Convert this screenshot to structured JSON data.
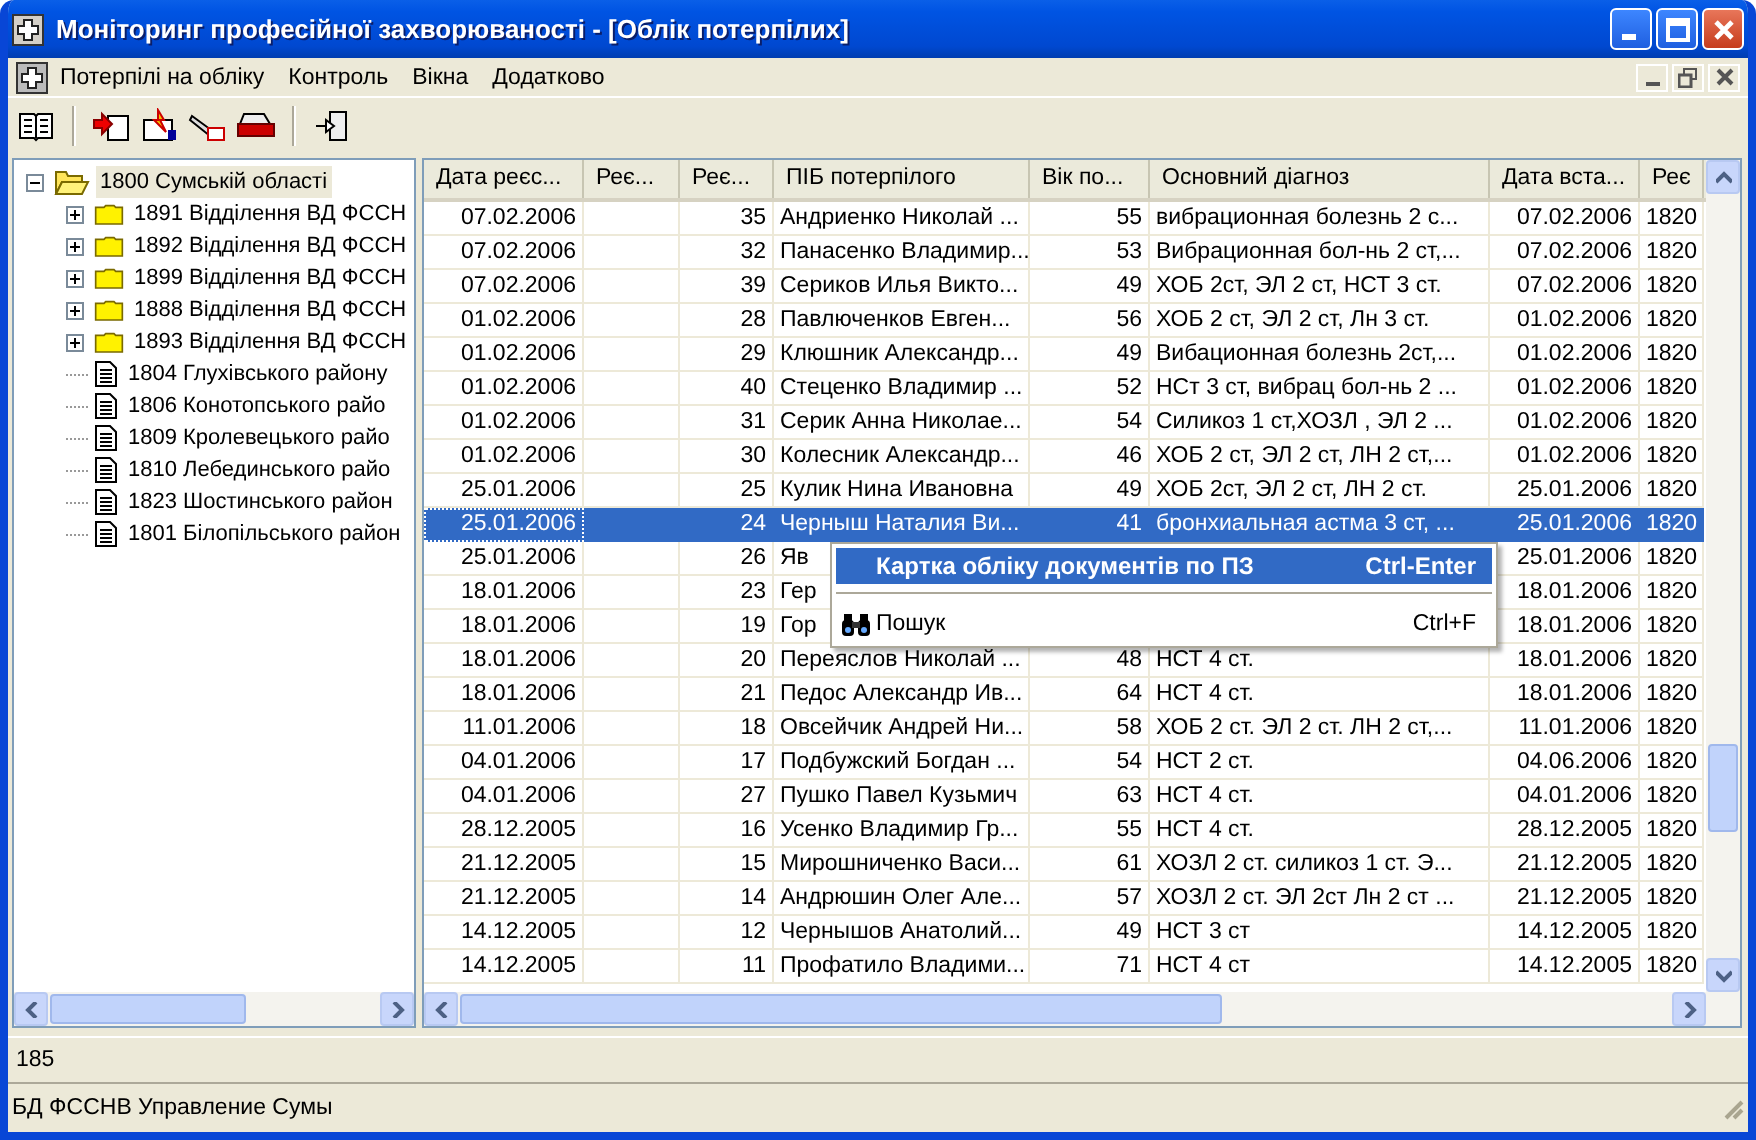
{
  "window": {
    "title": "Моніторинг професійної захворюваності - [Облік потерпілих]"
  },
  "menu": [
    "Потерпілі на обліку",
    "Контроль",
    "Вікна",
    "Додатково"
  ],
  "tree": [
    {
      "label": "1800  Сумській області",
      "kind": "folder",
      "expanded": true,
      "selected": true,
      "children": [
        {
          "label": "1891 Відділення ВД ФССН",
          "kind": "folder",
          "expanded": false,
          "selected": false
        },
        {
          "label": "1892 Відділення ВД ФССН",
          "kind": "folder",
          "expanded": false,
          "selected": false
        },
        {
          "label": "1899 Відділення ВД ФССН",
          "kind": "folder",
          "expanded": false,
          "selected": false
        },
        {
          "label": "1888 Відділення ВД ФССН",
          "kind": "folder",
          "expanded": false,
          "selected": false
        },
        {
          "label": "1893 Відділення ВД ФССН",
          "kind": "folder",
          "expanded": false,
          "selected": false
        },
        {
          "label": "1804 Глухівського району",
          "kind": "doc",
          "selected": false
        },
        {
          "label": "1806 Конотопського райо",
          "kind": "doc",
          "selected": false
        },
        {
          "label": "1809 Кролевецького райо",
          "kind": "doc",
          "selected": false
        },
        {
          "label": "1810 Лебединського райо",
          "kind": "doc",
          "selected": false
        },
        {
          "label": "1823 Шостинського район",
          "kind": "doc",
          "selected": false
        },
        {
          "label": "1801 Білопільського район",
          "kind": "doc",
          "selected": false
        }
      ]
    }
  ],
  "table": {
    "columns": [
      "Дата реєс...",
      "Реє...",
      "Реє...",
      "ПІБ потерпілого",
      "Вік по...",
      "Основний діагноз",
      "Дата вста...",
      "Реє"
    ],
    "rows": [
      {
        "date": "07.02.2006",
        "num": "35",
        "name": "Андриенко Николай ...",
        "age": "55",
        "diagnosis": "вибрационная болезнь 2 с...",
        "date2": "07.02.2006",
        "code": "1820",
        "selected": false
      },
      {
        "date": "07.02.2006",
        "num": "32",
        "name": "Панасенко Владимир...",
        "age": "53",
        "diagnosis": "Вибрационная бол-нь 2 ст,...",
        "date2": "07.02.2006",
        "code": "1820",
        "selected": false
      },
      {
        "date": "07.02.2006",
        "num": "39",
        "name": "Сериков Илья Викто...",
        "age": "49",
        "diagnosis": "ХОБ 2ст, ЭЛ 2 ст, НСТ 3 ст.",
        "date2": "07.02.2006",
        "code": "1820",
        "selected": false
      },
      {
        "date": "01.02.2006",
        "num": "28",
        "name": "Павлюченков Евген...",
        "age": "56",
        "diagnosis": "ХОБ 2 ст, ЭЛ 2 ст, Лн 3 ст.",
        "date2": "01.02.2006",
        "code": "1820",
        "selected": false
      },
      {
        "date": "01.02.2006",
        "num": "29",
        "name": "Клюшник Александр...",
        "age": "49",
        "diagnosis": "Вибационная болезнь 2ст,...",
        "date2": "01.02.2006",
        "code": "1820",
        "selected": false
      },
      {
        "date": "01.02.2006",
        "num": "40",
        "name": "Стеценко Владимир ...",
        "age": "52",
        "diagnosis": "НСт 3 ст, вибрац бол-нь 2 ...",
        "date2": "01.02.2006",
        "code": "1820",
        "selected": false
      },
      {
        "date": "01.02.2006",
        "num": "31",
        "name": "Серик Анна Николае...",
        "age": "54",
        "diagnosis": "Силикоз 1 ст,ХОЗЛ , ЭЛ 2 ...",
        "date2": "01.02.2006",
        "code": "1820",
        "selected": false
      },
      {
        "date": "01.02.2006",
        "num": "30",
        "name": "Колесник Александр...",
        "age": "46",
        "diagnosis": "ХОБ 2 ст, ЭЛ 2 ст, ЛН 2 ст,...",
        "date2": "01.02.2006",
        "code": "1820",
        "selected": false
      },
      {
        "date": "25.01.2006",
        "num": "25",
        "name": "Кулик Нина Ивановна",
        "age": "49",
        "diagnosis": "ХОБ 2ст, ЭЛ 2 ст, ЛН 2 ст.",
        "date2": "25.01.2006",
        "code": "1820",
        "selected": false
      },
      {
        "date": "25.01.2006",
        "num": "24",
        "name": "Черныш Наталия Ви...",
        "age": "41",
        "diagnosis": "бронхиальная астма 3 ст, ...",
        "date2": "25.01.2006",
        "code": "1820",
        "selected": true
      },
      {
        "date": "25.01.2006",
        "num": "26",
        "name": "Яв",
        "date2": "25.01.2006",
        "code": "1820",
        "selected": false
      },
      {
        "date": "18.01.2006",
        "num": "23",
        "name": "Гер",
        "date2": "18.01.2006",
        "code": "1820",
        "selected": false
      },
      {
        "date": "18.01.2006",
        "num": "19",
        "name": "Гор",
        "date2": "18.01.2006",
        "code": "1820",
        "selected": false
      },
      {
        "date": "18.01.2006",
        "num": "20",
        "name": "Переяслов Николай ...",
        "age": "48",
        "diagnosis": "НСТ 4 ст.",
        "date2": "18.01.2006",
        "code": "1820",
        "selected": false
      },
      {
        "date": "18.01.2006",
        "num": "21",
        "name": "Педос Александр Ив...",
        "age": "64",
        "diagnosis": "НСТ 4 ст.",
        "date2": "18.01.2006",
        "code": "1820",
        "selected": false
      },
      {
        "date": "11.01.2006",
        "num": "18",
        "name": "Овсейчик Андрей Ни...",
        "age": "58",
        "diagnosis": "ХОБ 2 ст. ЭЛ 2 ст. ЛН 2 ст,...",
        "date2": "11.01.2006",
        "code": "1820",
        "selected": false
      },
      {
        "date": "04.01.2006",
        "num": "17",
        "name": "Подбужский Богдан ...",
        "age": "54",
        "diagnosis": "НСТ 2 ст.",
        "date2": "04.06.2006",
        "code": "1820",
        "selected": false
      },
      {
        "date": "04.01.2006",
        "num": "27",
        "name": "Пушко Павел Кузьмич",
        "age": "63",
        "diagnosis": "НСТ 4 ст.",
        "date2": "04.01.2006",
        "code": "1820",
        "selected": false
      },
      {
        "date": "28.12.2005",
        "num": "16",
        "name": "Усенко Владимир Гр...",
        "age": "55",
        "diagnosis": "НСТ 4 ст.",
        "date2": "28.12.2005",
        "code": "1820",
        "selected": false
      },
      {
        "date": "21.12.2005",
        "num": "15",
        "name": "Мирошниченко Васи...",
        "age": "61",
        "diagnosis": "ХОЗЛ 2 ст. силикоз 1 ст. Э...",
        "date2": "21.12.2005",
        "code": "1820",
        "selected": false
      },
      {
        "date": "21.12.2005",
        "num": "14",
        "name": "Андрюшин Олег Але...",
        "age": "57",
        "diagnosis": "ХОЗЛ 2 ст. ЭЛ 2ст Лн 2 ст ...",
        "date2": "21.12.2005",
        "code": "1820",
        "selected": false
      },
      {
        "date": "14.12.2005",
        "num": "12",
        "name": "Чернышов Анатолий...",
        "age": "49",
        "diagnosis": "НСТ 3 ст",
        "date2": "14.12.2005",
        "code": "1820",
        "selected": false
      },
      {
        "date": "14.12.2005",
        "num": "11",
        "name": "Профатило Владими...",
        "age": "71",
        "diagnosis": "НСТ 4 ст",
        "date2": "14.12.2005",
        "code": "1820",
        "selected": false
      }
    ]
  },
  "context_menu": [
    {
      "kind": "default",
      "label": "Картка обліку документів по ПЗ",
      "shortcut": "Ctrl-Enter",
      "selected": true
    },
    {
      "kind": "separator"
    },
    {
      "kind": "search",
      "label": "Пошук",
      "shortcut": "Ctrl+F",
      "selected": false
    }
  ],
  "record_count": "185",
  "status_bar": "БД ФССНВ Управление Сумы"
}
